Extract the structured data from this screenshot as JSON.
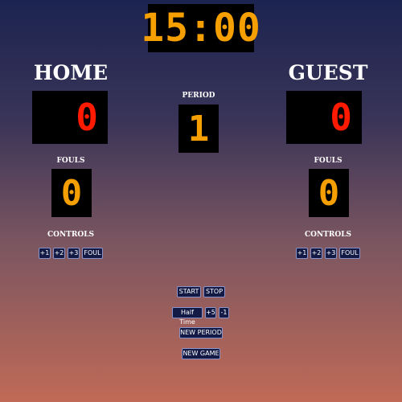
{
  "clock": {
    "time": "15:00"
  },
  "home": {
    "name": "HOME",
    "score": "0",
    "fouls_label": "FOULS",
    "fouls": "0",
    "controls_label": "CONTROLS",
    "buttons": [
      "+1",
      "+2",
      "+3",
      "FOUL"
    ]
  },
  "guest": {
    "name": "GUEST",
    "score": "0",
    "fouls_label": "FOULS",
    "fouls": "0",
    "controls_label": "CONTROLS",
    "buttons": [
      "+1",
      "+2",
      "+3",
      "FOUL"
    ]
  },
  "period": {
    "label": "PERIOD",
    "value": "1"
  },
  "game_controls": {
    "start": "START",
    "stop": "STOP",
    "half_time": "Half Time",
    "plus5": "+5",
    "minus1": "-1",
    "new_period": "NEW PERIOD",
    "new_game": "NEW GAME"
  },
  "colors": {
    "score": "#ff1a00",
    "clock": "#f5a000",
    "button_bg": "#121a45"
  }
}
